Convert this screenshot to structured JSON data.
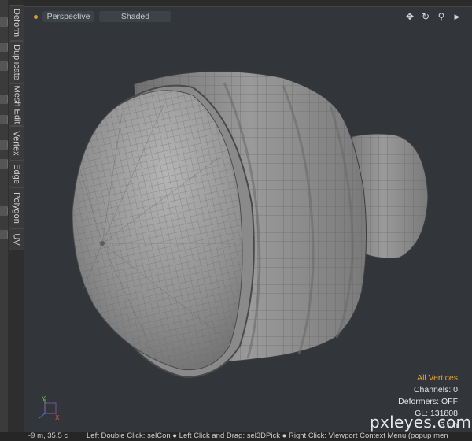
{
  "side_tabs": [
    "Deform",
    "Duplicate",
    "Mesh Edit",
    "Vertex",
    "Edge",
    "Polygon",
    "UV"
  ],
  "viewport": {
    "view_mode": "Perspective",
    "shading_mode": "Shaded",
    "info": {
      "selection_mode": "All Vertices",
      "channels": "Channels: 0",
      "deformers": "Deformers: OFF",
      "gl": "GL: 131808",
      "grid": "5 cm"
    },
    "axis_labels": {
      "y": "Y",
      "x": "X"
    }
  },
  "status_bar": {
    "coords": "-9 m, 35.5 c",
    "help": "Left Double Click: selCon ● Left Click and Drag: sel3DPick ● Right Click: Viewport Context Menu (popup men"
  },
  "watermark": "pxleyes.com",
  "colors": {
    "accent": "#e8a32c",
    "viewport_bg": "#32363b",
    "mesh": "#8e8e8e",
    "wire": "#5a5a5a"
  }
}
